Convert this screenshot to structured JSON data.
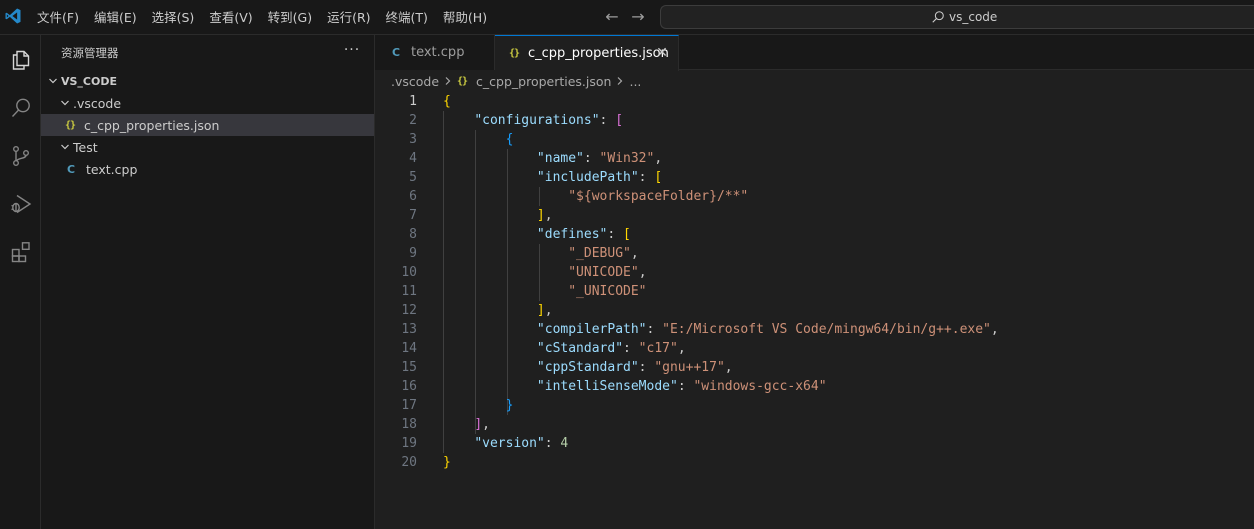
{
  "titlebar": {
    "menu": [
      "文件(F)",
      "编辑(E)",
      "选择(S)",
      "查看(V)",
      "转到(G)",
      "运行(R)",
      "终端(T)",
      "帮助(H)"
    ],
    "search_text": "vs_code"
  },
  "activitybar": {
    "icons": [
      "explorer-icon",
      "search-icon",
      "source-control-icon",
      "run-debug-icon",
      "extensions-icon"
    ],
    "active": "explorer-icon"
  },
  "sidebar": {
    "title": "资源管理器",
    "more": "···",
    "tree": {
      "root": "VS_CODE",
      "vscode_folder": ".vscode",
      "json_file": "c_cpp_properties.json",
      "test_folder": "Test",
      "cpp_file": "text.cpp"
    },
    "icon_glyphs": {
      "json": "{}",
      "cpp": "C"
    }
  },
  "editor": {
    "tabs": [
      {
        "label": "text.cpp",
        "icon": "C",
        "active": false
      },
      {
        "label": "c_cpp_properties.json",
        "icon": "{}",
        "active": true
      }
    ],
    "breadcrumb": {
      "folder": ".vscode",
      "file": "c_cpp_properties.json",
      "more": "..."
    },
    "current_line": 1,
    "lines": [
      [
        [
          "b1",
          "{"
        ]
      ],
      [
        [
          "p",
          "    "
        ],
        [
          "key",
          "\"configurations\""
        ],
        [
          "p",
          ": "
        ],
        [
          "b2",
          "["
        ]
      ],
      [
        [
          "p",
          "        "
        ],
        [
          "b3",
          "{"
        ]
      ],
      [
        [
          "p",
          "            "
        ],
        [
          "key",
          "\"name\""
        ],
        [
          "p",
          ": "
        ],
        [
          "str",
          "\"Win32\""
        ],
        [
          "p",
          ","
        ]
      ],
      [
        [
          "p",
          "            "
        ],
        [
          "key",
          "\"includePath\""
        ],
        [
          "p",
          ": "
        ],
        [
          "b1",
          "["
        ]
      ],
      [
        [
          "p",
          "                "
        ],
        [
          "str",
          "\"${workspaceFolder}/**\""
        ]
      ],
      [
        [
          "p",
          "            "
        ],
        [
          "b1",
          "]"
        ],
        [
          "p",
          ","
        ]
      ],
      [
        [
          "p",
          "            "
        ],
        [
          "key",
          "\"defines\""
        ],
        [
          "p",
          ": "
        ],
        [
          "b1",
          "["
        ]
      ],
      [
        [
          "p",
          "                "
        ],
        [
          "str",
          "\"_DEBUG\""
        ],
        [
          "p",
          ","
        ]
      ],
      [
        [
          "p",
          "                "
        ],
        [
          "str",
          "\"UNICODE\""
        ],
        [
          "p",
          ","
        ]
      ],
      [
        [
          "p",
          "                "
        ],
        [
          "str",
          "\"_UNICODE\""
        ]
      ],
      [
        [
          "p",
          "            "
        ],
        [
          "b1",
          "]"
        ],
        [
          "p",
          ","
        ]
      ],
      [
        [
          "p",
          "            "
        ],
        [
          "key",
          "\"compilerPath\""
        ],
        [
          "p",
          ": "
        ],
        [
          "str",
          "\"E:/Microsoft VS Code/mingw64/bin/g++.exe\""
        ],
        [
          "p",
          ","
        ]
      ],
      [
        [
          "p",
          "            "
        ],
        [
          "key",
          "\"cStandard\""
        ],
        [
          "p",
          ": "
        ],
        [
          "str",
          "\"c17\""
        ],
        [
          "p",
          ","
        ]
      ],
      [
        [
          "p",
          "            "
        ],
        [
          "key",
          "\"cppStandard\""
        ],
        [
          "p",
          ": "
        ],
        [
          "str",
          "\"gnu++17\""
        ],
        [
          "p",
          ","
        ]
      ],
      [
        [
          "p",
          "            "
        ],
        [
          "key",
          "\"intelliSenseMode\""
        ],
        [
          "p",
          ": "
        ],
        [
          "str",
          "\"windows-gcc-x64\""
        ]
      ],
      [
        [
          "p",
          "        "
        ],
        [
          "b3",
          "}"
        ]
      ],
      [
        [
          "p",
          "    "
        ],
        [
          "b2",
          "]"
        ],
        [
          "p",
          ","
        ]
      ],
      [
        [
          "p",
          "    "
        ],
        [
          "key",
          "\"version\""
        ],
        [
          "p",
          ": "
        ],
        [
          "num",
          "4"
        ]
      ],
      [
        [
          "b1",
          "}"
        ]
      ]
    ]
  },
  "colors": {
    "accent": "#0078d4",
    "vscode_blue": "#2489ca",
    "json_icon": "#cbcb41",
    "cpp_icon": "#519aba",
    "key": "#9cdcfe",
    "string": "#ce9178",
    "number": "#b5cea8"
  }
}
